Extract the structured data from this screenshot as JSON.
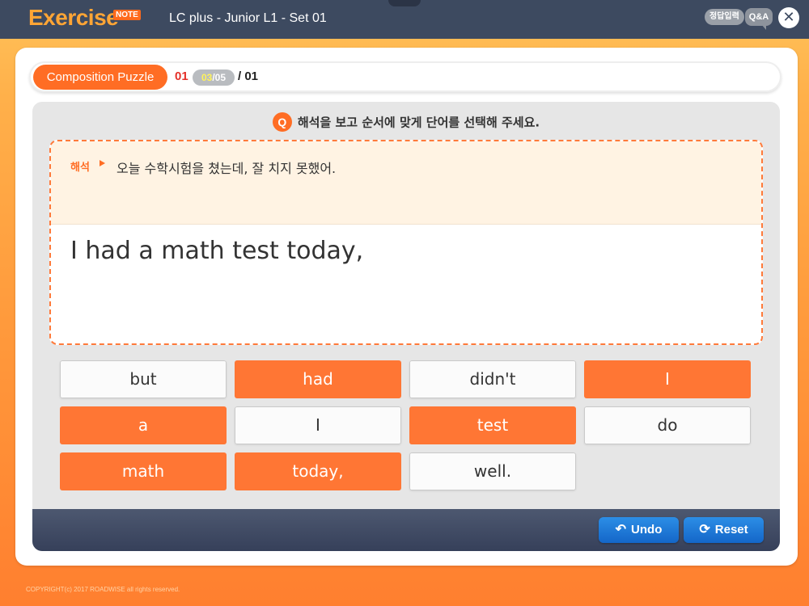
{
  "header": {
    "logo": "Exercise",
    "logo_badge": "NOTE",
    "title": "LC plus - Junior L1 - Set 01",
    "answer_button": "정답입력",
    "qa_button": "Q&A",
    "close_icon": "close-icon"
  },
  "titlebar": {
    "label": "Composition Puzzle",
    "number": "01",
    "step_current": "03",
    "step_sep": "/",
    "step_total": "05",
    "total_label": "/ 01"
  },
  "question": {
    "badge": "Q",
    "text": "해석을 보고 순서에 맞게 단어를 선택해 주세요."
  },
  "translation": {
    "label": "해석",
    "text": "오늘 수학시험을 쳤는데, 잘 치지 못했어."
  },
  "sentence": "I had a math test today,",
  "tiles": [
    {
      "word": "but",
      "state": "unselected"
    },
    {
      "word": "had",
      "state": "selected"
    },
    {
      "word": "didn't",
      "state": "unselected"
    },
    {
      "word": "I",
      "state": "selected"
    },
    {
      "word": "a",
      "state": "selected"
    },
    {
      "word": "I",
      "state": "unselected"
    },
    {
      "word": "test",
      "state": "selected"
    },
    {
      "word": "do",
      "state": "unselected"
    },
    {
      "word": "math",
      "state": "selected"
    },
    {
      "word": "today,",
      "state": "selected"
    },
    {
      "word": "well.",
      "state": "unselected"
    }
  ],
  "buttons": {
    "undo": "Undo",
    "reset": "Reset",
    "undo_icon": "undo-icon",
    "reset_icon": "refresh-icon"
  },
  "copyright": "COPYRIGHT(c) 2017 ROADWISE all rights reserved.",
  "colors": {
    "accent": "#ff6d24",
    "header_bg": "#3d4a60",
    "button_blue": "#1d7bd8"
  }
}
